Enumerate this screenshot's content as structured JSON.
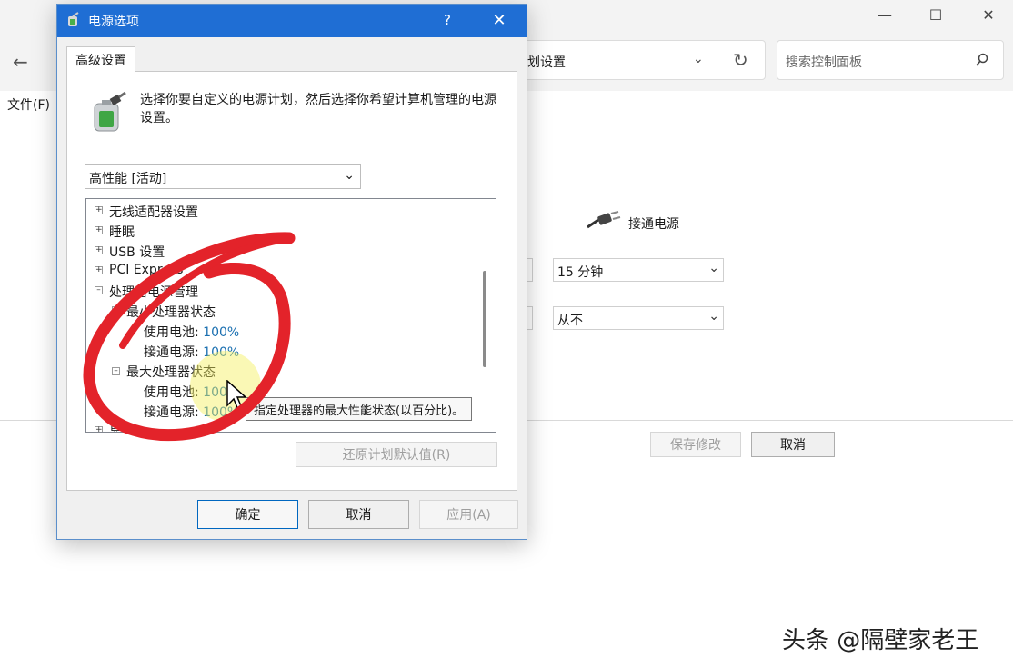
{
  "background_window": {
    "address_text": "划设置",
    "search_placeholder": "搜索控制面板",
    "menu_file": "文件(F)",
    "plugged_in_label": "接通电源",
    "sleep_value": "15 分钟",
    "hibernate_value": "从不",
    "save_button": "保存修改",
    "cancel_button": "取消"
  },
  "dialog": {
    "title": "电源选项",
    "help": "?",
    "tab": "高级设置",
    "description": "选择你要自定义的电源计划，然后选择你希望计算机管理的电源设置。",
    "plan_selected": "高性能 [活动]",
    "tree": {
      "wireless": "无线适配器设置",
      "sleep": "睡眠",
      "usb": "USB 设置",
      "pci": "PCI Express",
      "processor": "处理器电源管理",
      "min_state": "最小处理器状态",
      "max_state": "最大处理器状态",
      "battery_label": "使用电池:",
      "plugged_label": "接通电源:",
      "min_battery": "100%",
      "min_plugged": "100%",
      "max_battery": "100%",
      "max_plugged": "100%",
      "display": "显示"
    },
    "tooltip": "指定处理器的最大性能状态(以百分比)。",
    "restore_button": "还原计划默认值(R)",
    "ok_button": "确定",
    "cancel_button": "取消",
    "apply_button": "应用(A)"
  },
  "watermark": "头条 @隔壁家老王",
  "colors": {
    "titlebar": "#1f6ed4",
    "value_blue": "#1a6fb0",
    "annotation_red": "#e3232a"
  }
}
